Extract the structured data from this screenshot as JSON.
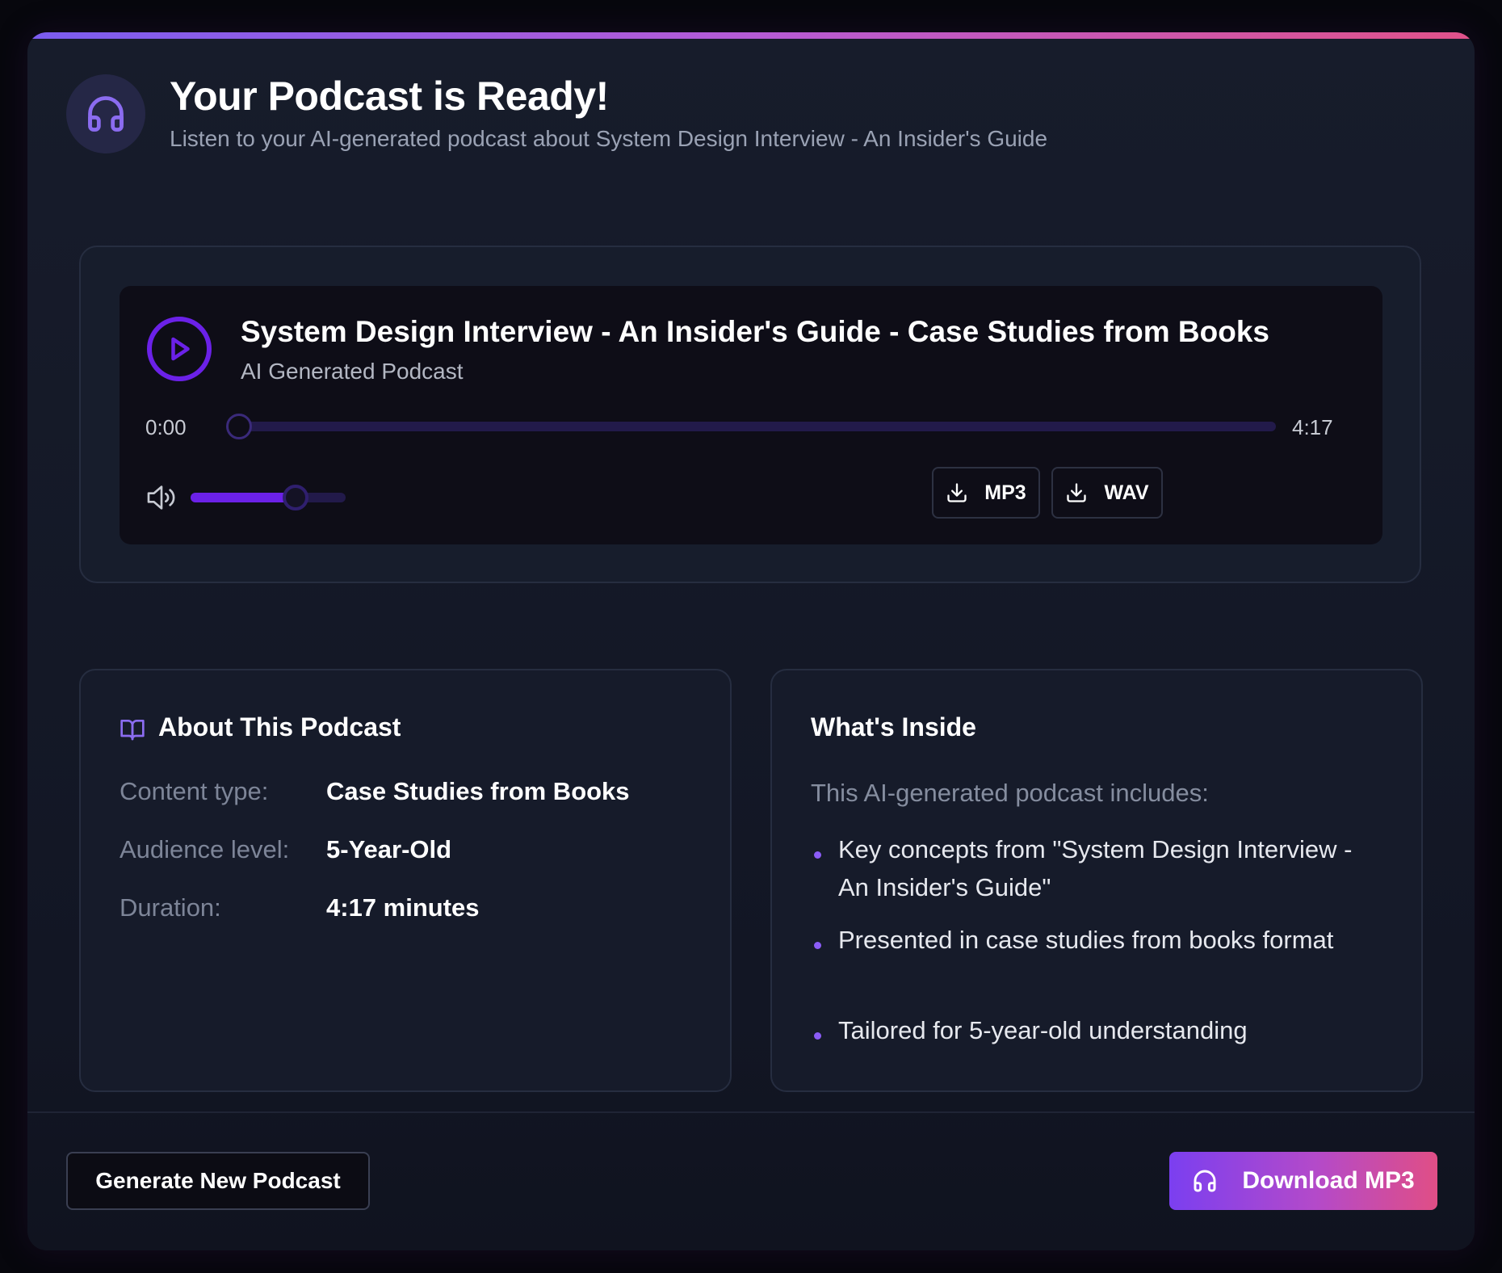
{
  "header": {
    "title": "Your Podcast is Ready!",
    "subtitle": "Listen to your AI-generated podcast about System Design Interview - An Insider's Guide",
    "icon": "headphones-icon"
  },
  "player": {
    "title": "System Design Interview - An Insider's Guide - Case Studies from Books",
    "subtitle": "AI Generated Podcast",
    "current_time": "0:00",
    "duration": "4:17",
    "progress": 0,
    "volume": 0.75,
    "download_mp3_label": "MP3",
    "download_wav_label": "WAV"
  },
  "about": {
    "heading": "About This Podcast",
    "rows": [
      {
        "label": "Content type:",
        "value": "Case Studies from Books"
      },
      {
        "label": "Audience level:",
        "value": "5-Year-Old"
      },
      {
        "label": "Duration:",
        "value": "4:17 minutes"
      }
    ]
  },
  "inside": {
    "heading": "What's Inside",
    "intro": "This AI-generated podcast includes:",
    "items": [
      "Key concepts from \"System Design Interview - An Insider's Guide\"",
      "Presented in case studies from books format",
      "Tailored for 5-year-old understanding"
    ]
  },
  "footer": {
    "new_label": "Generate New Podcast",
    "download_label": "Download MP3"
  },
  "colors": {
    "accent": "#6b21e8",
    "gradient_start": "#7b3ff0",
    "gradient_end": "#e04e86"
  }
}
